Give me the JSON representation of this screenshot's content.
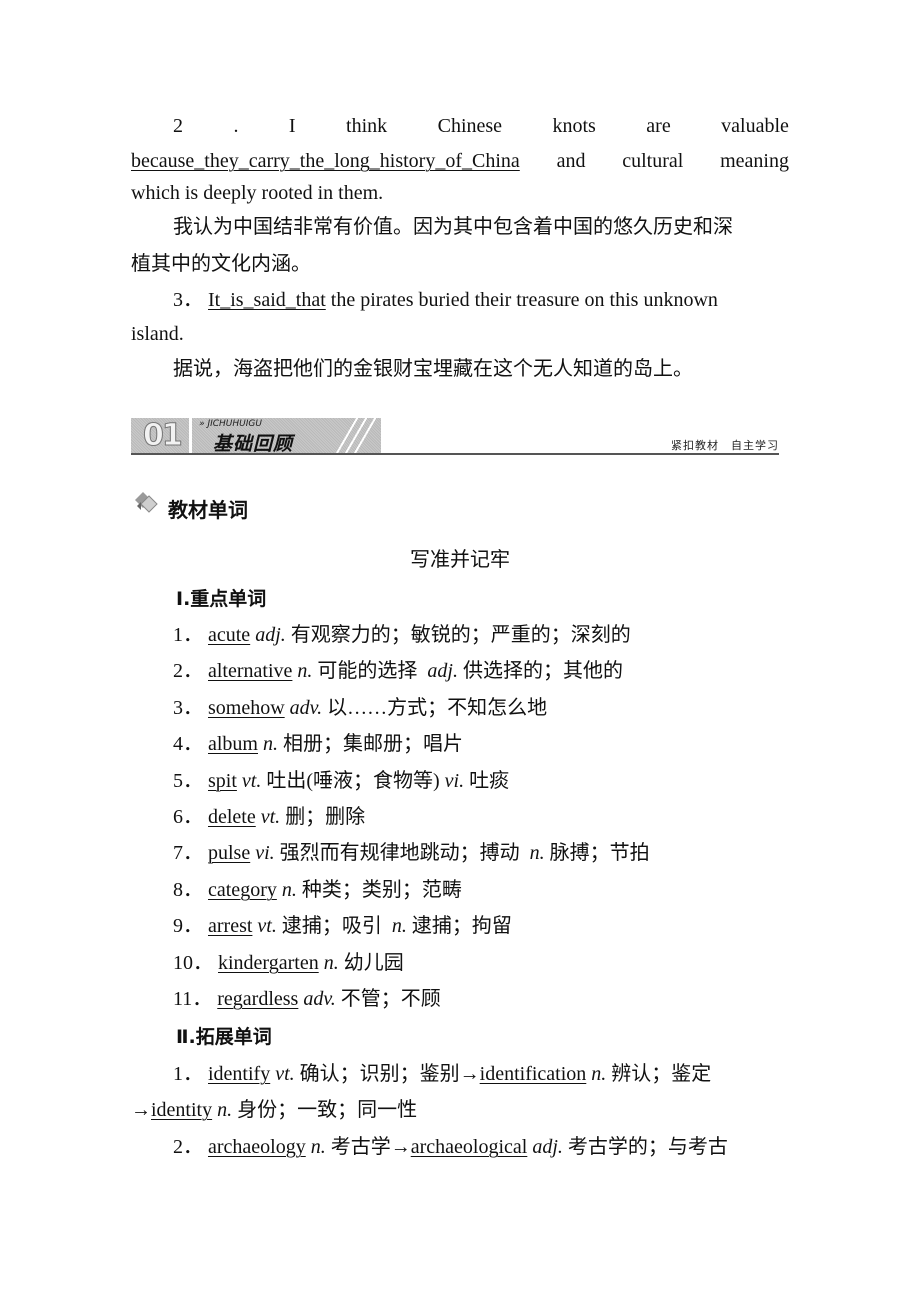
{
  "intro": {
    "item2": {
      "number": "2",
      "dot": ".",
      "line1_words": [
        "I",
        "think",
        "Chinese",
        "knots",
        "are",
        "valuable"
      ],
      "answer": "because_they_carry_the_long_history_of_China",
      "line2_rest_words": [
        "and",
        "cultural",
        "meaning"
      ],
      "line3": "which is deeply rooted in them.",
      "translation_line1": "我认为中国结非常有价值。因为其中包含着中国的悠久历史和深",
      "translation_line2": "植其中的文化内涵。"
    },
    "item3": {
      "number": "3．",
      "answer": "It_is_said_that",
      "rest": " the pirates buried their treasure on this unknown",
      "line2": "island.",
      "translation": "据说，海盗把他们的金银财宝埋藏在这个无人知道的岛上。"
    }
  },
  "banner": {
    "number": "01",
    "pinyin": "JICHUHUIGU",
    "title": "基础回顾",
    "right_text": "紧扣教材　自主学习"
  },
  "section": {
    "title": "教材单词",
    "subtitle": "写准并记牢",
    "part1": {
      "heading": "Ⅰ.重点单词",
      "items": [
        {
          "num": "1．",
          "word": "acute",
          "segments": [
            {
              "t": " adj.",
              "i": true
            },
            {
              "t": " 有观察力的；敏锐的；严重的；深刻的",
              "i": false
            }
          ]
        },
        {
          "num": "2．",
          "word": "alternative",
          "segments": [
            {
              "t": " n.",
              "i": true
            },
            {
              "t": " 可能的选择  ",
              "i": false
            },
            {
              "t": "adj.",
              "i": true
            },
            {
              "t": " 供选择的；其他的",
              "i": false
            }
          ]
        },
        {
          "num": "3．",
          "word": "somehow",
          "segments": [
            {
              "t": " adv.",
              "i": true
            },
            {
              "t": " 以……方式；不知怎么地",
              "i": false
            }
          ]
        },
        {
          "num": "4．",
          "word": "album",
          "segments": [
            {
              "t": " n.",
              "i": true
            },
            {
              "t": " 相册；集邮册；唱片",
              "i": false
            }
          ]
        },
        {
          "num": "5．",
          "word": "spit",
          "segments": [
            {
              "t": " vt.",
              "i": true
            },
            {
              "t": " 吐出(唾液；食物等) ",
              "i": false
            },
            {
              "t": "vi.",
              "i": true
            },
            {
              "t": " 吐痰",
              "i": false
            }
          ]
        },
        {
          "num": "6．",
          "word": "delete",
          "segments": [
            {
              "t": " vt.",
              "i": true
            },
            {
              "t": " 删；删除",
              "i": false
            }
          ]
        },
        {
          "num": "7．",
          "word": "pulse",
          "segments": [
            {
              "t": " vi.",
              "i": true
            },
            {
              "t": " 强烈而有规律地跳动；搏动  ",
              "i": false
            },
            {
              "t": "n.",
              "i": true
            },
            {
              "t": " 脉搏；节拍",
              "i": false
            }
          ]
        },
        {
          "num": "8．",
          "word": "category",
          "segments": [
            {
              "t": " n.",
              "i": true
            },
            {
              "t": " 种类；类别；范畴",
              "i": false
            }
          ]
        },
        {
          "num": "9．",
          "word": "arrest",
          "segments": [
            {
              "t": " vt.",
              "i": true
            },
            {
              "t": " 逮捕；吸引  ",
              "i": false
            },
            {
              "t": "n.",
              "i": true
            },
            {
              "t": " 逮捕；拘留",
              "i": false
            }
          ]
        },
        {
          "num": "10．",
          "word": "kindergarten",
          "segments": [
            {
              "t": " n.",
              "i": true
            },
            {
              "t": " 幼儿园",
              "i": false
            }
          ]
        },
        {
          "num": "11．",
          "word": "regardless",
          "segments": [
            {
              "t": " adv.",
              "i": true
            },
            {
              "t": " 不管；不顾",
              "i": false
            }
          ]
        }
      ]
    },
    "part2": {
      "heading": "Ⅱ.拓展单词",
      "item1": {
        "num": "1．",
        "word": "identify",
        "pos1": " vt.",
        "meaning1": " 确认；识别；鉴别→",
        "word2": "identification",
        "pos2": " n.",
        "meaning2": " 辨认；鉴定",
        "arrow": "→",
        "word3": "identity",
        "pos3": " n.",
        "meaning3": " 身份；一致；同一性"
      },
      "item2": {
        "num": "2．",
        "word": "archaeology",
        "pos1": " n.",
        "meaning1": " 考古学→",
        "word2": "archaeological",
        "pos2": " adj.",
        "meaning2": " 考古学的；与考古"
      }
    }
  }
}
